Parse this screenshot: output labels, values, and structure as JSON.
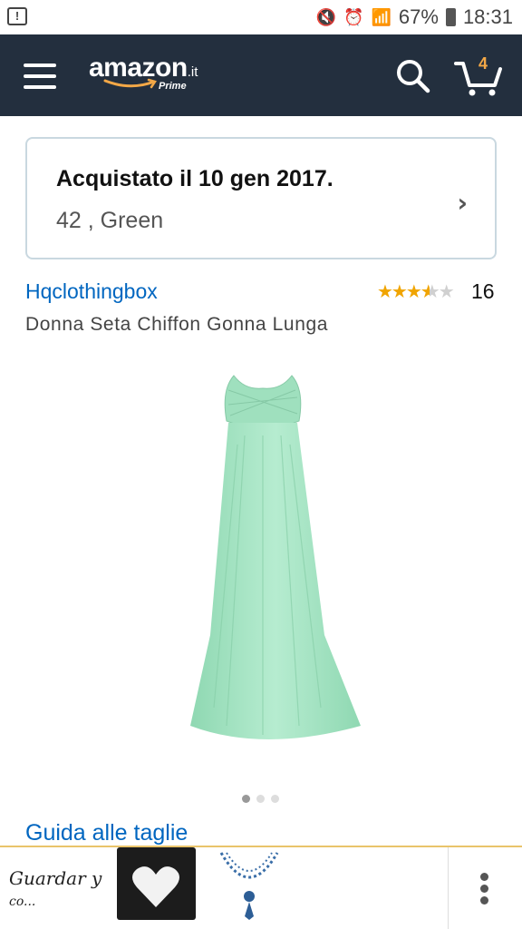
{
  "status_bar": {
    "notification_icon": "alert-icon",
    "battery": "67%",
    "time": "18:31"
  },
  "header": {
    "logo_text": "amazon",
    "logo_tld": ".it",
    "logo_badge": "Prime",
    "cart_count": "4"
  },
  "order": {
    "title": "Acquistato il 10 gen 2017.",
    "detail": "42 , Green"
  },
  "product": {
    "brand": "Hqclothingbox",
    "rating": 3.5,
    "review_count": "16",
    "title": "Donna Seta Chiffon Gonna Lunga",
    "image_pager": {
      "current": 1,
      "total": 3
    }
  },
  "size_guide_link": "Guida alle taglie",
  "bottom_bar": {
    "text_line1": "Guardar y",
    "text_line2": "co..."
  },
  "colors": {
    "header_bg": "#232f3e",
    "link": "#0066c0",
    "star": "#f0a400",
    "dress": "#a8e4c4"
  }
}
